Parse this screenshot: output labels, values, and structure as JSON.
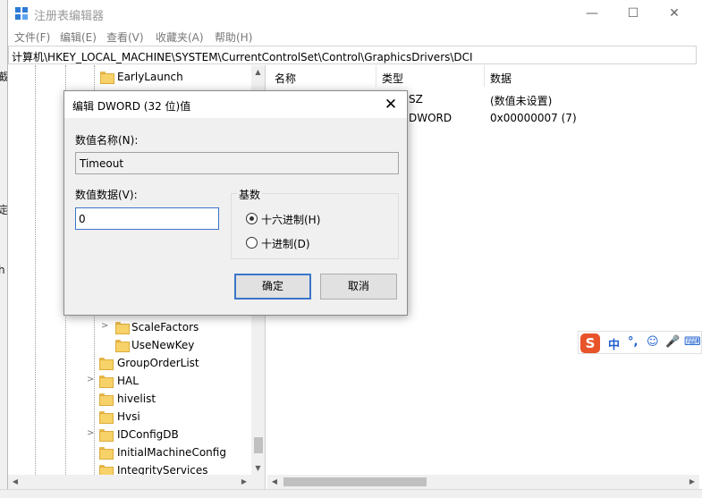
{
  "window": {
    "title": "注册表编辑器",
    "minimize": "—",
    "maximize": "☐",
    "close": "✕"
  },
  "menu": [
    "文件(F)",
    "编辑(E)",
    "查看(V)",
    "收藏夹(A)",
    "帮助(H)"
  ],
  "address": "计算机\\HKEY_LOCAL_MACHINE\\SYSTEM\\CurrentControlSet\\Control\\GraphicsDrivers\\DCI",
  "left_edge_fragments": [
    "截",
    "定",
    "h"
  ],
  "tree": [
    {
      "label": "EarlyLaunch",
      "expander": ""
    },
    {
      "label": "ScaleFactors",
      "expander": ">"
    },
    {
      "label": "UseNewKey",
      "expander": ""
    },
    {
      "label": "GroupOrderList",
      "expander": ""
    },
    {
      "label": "HAL",
      "expander": ">"
    },
    {
      "label": "hivelist",
      "expander": ""
    },
    {
      "label": "Hvsi",
      "expander": ""
    },
    {
      "label": "IDConfigDB",
      "expander": ">"
    },
    {
      "label": "InitialMachineConfig",
      "expander": ""
    },
    {
      "label": "IntegrityServices",
      "expander": ""
    }
  ],
  "list": {
    "headers": {
      "name": "名称",
      "type": "类型",
      "data": "数据"
    },
    "rows": [
      {
        "type": "SZ",
        "data": "(数值未设置)"
      },
      {
        "type": "DWORD",
        "data": "0x00000007 (7)"
      }
    ]
  },
  "dialog": {
    "title": "编辑 DWORD (32 位)值",
    "close": "✕",
    "name_label": "数值名称(N):",
    "name_value": "Timeout",
    "data_label": "数值数据(V):",
    "data_value": "0",
    "base_label": "基数",
    "radio_hex": "十六进制(H)",
    "radio_dec": "十进制(D)",
    "selected_base": "hex",
    "ok": "确定",
    "cancel": "取消"
  },
  "ime": {
    "logo": "S",
    "items": [
      "中",
      "°,",
      "☺",
      "🎤",
      "⌨"
    ]
  },
  "colors": {
    "accent": "#3b75c9",
    "folder": "#f7d268",
    "ime_logo": "#e8532a"
  }
}
